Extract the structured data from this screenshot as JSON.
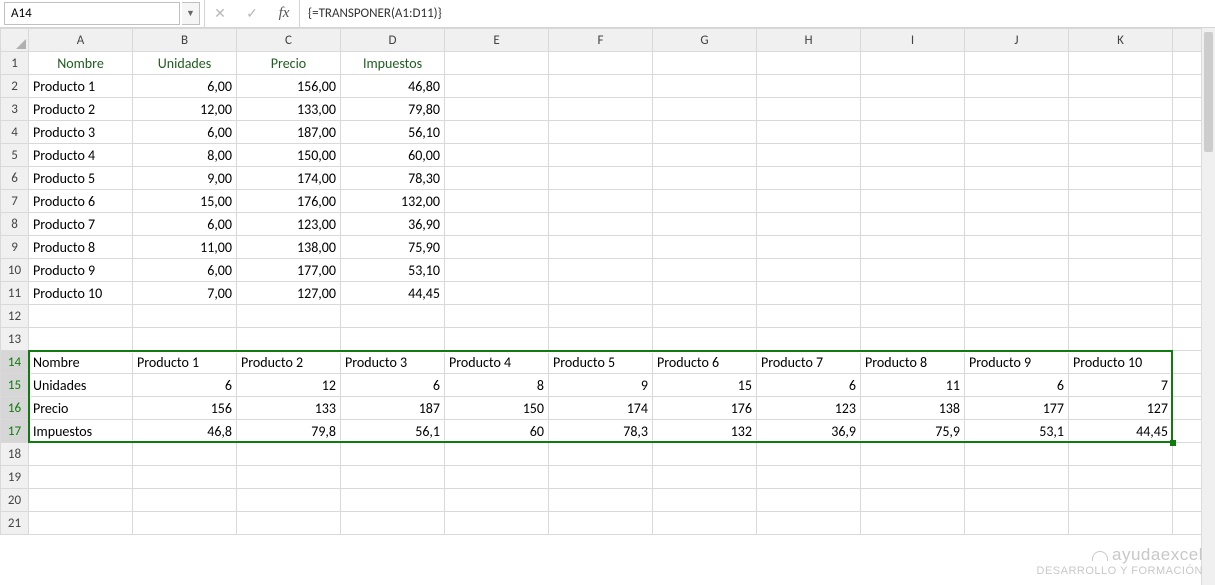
{
  "name_box": "A14",
  "formula": "{=TRANSPONER(A1:D11)}",
  "columns": [
    "A",
    "B",
    "C",
    "D",
    "E",
    "F",
    "G",
    "H",
    "I",
    "J",
    "K"
  ],
  "row_numbers": [
    "1",
    "2",
    "3",
    "4",
    "5",
    "6",
    "7",
    "8",
    "9",
    "10",
    "11",
    "12",
    "13",
    "14",
    "15",
    "16",
    "17",
    "18",
    "19",
    "20",
    "21"
  ],
  "headers": {
    "a": "Nombre",
    "b": "Unidades",
    "c": "Precio",
    "d": "Impuestos"
  },
  "products": [
    {
      "name": "Producto 1",
      "units": "6,00",
      "price": "156,00",
      "tax": "46,80"
    },
    {
      "name": "Producto 2",
      "units": "12,00",
      "price": "133,00",
      "tax": "79,80"
    },
    {
      "name": "Producto 3",
      "units": "6,00",
      "price": "187,00",
      "tax": "56,10"
    },
    {
      "name": "Producto 4",
      "units": "8,00",
      "price": "150,00",
      "tax": "60,00"
    },
    {
      "name": "Producto 5",
      "units": "9,00",
      "price": "174,00",
      "tax": "78,30"
    },
    {
      "name": "Producto 6",
      "units": "15,00",
      "price": "176,00",
      "tax": "132,00"
    },
    {
      "name": "Producto 7",
      "units": "6,00",
      "price": "123,00",
      "tax": "36,90"
    },
    {
      "name": "Producto 8",
      "units": "11,00",
      "price": "138,00",
      "tax": "75,90"
    },
    {
      "name": "Producto 9",
      "units": "6,00",
      "price": "177,00",
      "tax": "53,10"
    },
    {
      "name": "Producto 10",
      "units": "7,00",
      "price": "127,00",
      "tax": "44,45"
    }
  ],
  "transposed": {
    "row14": [
      "Nombre",
      "Producto 1",
      "Producto 2",
      "Producto 3",
      "Producto 4",
      "Producto 5",
      "Producto 6",
      "Producto 7",
      "Producto 8",
      "Producto 9",
      "Producto 10"
    ],
    "row15": [
      "Unidades",
      "6",
      "12",
      "6",
      "8",
      "9",
      "15",
      "6",
      "11",
      "6",
      "7"
    ],
    "row16": [
      "Precio",
      "156",
      "133",
      "187",
      "150",
      "174",
      "176",
      "123",
      "138",
      "177",
      "127"
    ],
    "row17": [
      "Impuestos",
      "46,8",
      "79,8",
      "56,1",
      "60",
      "78,3",
      "132",
      "36,9",
      "75,9",
      "53,1",
      "44,45"
    ]
  },
  "watermark": {
    "brand": "ayudaexcel",
    "tag": "DESARROLLO Y FORMACIÓN"
  },
  "chart_data": {
    "type": "table",
    "headers": [
      "Nombre",
      "Unidades",
      "Precio",
      "Impuestos"
    ],
    "rows": [
      [
        "Producto 1",
        6,
        156,
        46.8
      ],
      [
        "Producto 2",
        12,
        133,
        79.8
      ],
      [
        "Producto 3",
        6,
        187,
        56.1
      ],
      [
        "Producto 4",
        8,
        150,
        60.0
      ],
      [
        "Producto 5",
        9,
        174,
        78.3
      ],
      [
        "Producto 6",
        15,
        176,
        132.0
      ],
      [
        "Producto 7",
        6,
        123,
        36.9
      ],
      [
        "Producto 8",
        11,
        138,
        75.9
      ],
      [
        "Producto 9",
        6,
        177,
        53.1
      ],
      [
        "Producto 10",
        7,
        127,
        44.45
      ]
    ]
  }
}
